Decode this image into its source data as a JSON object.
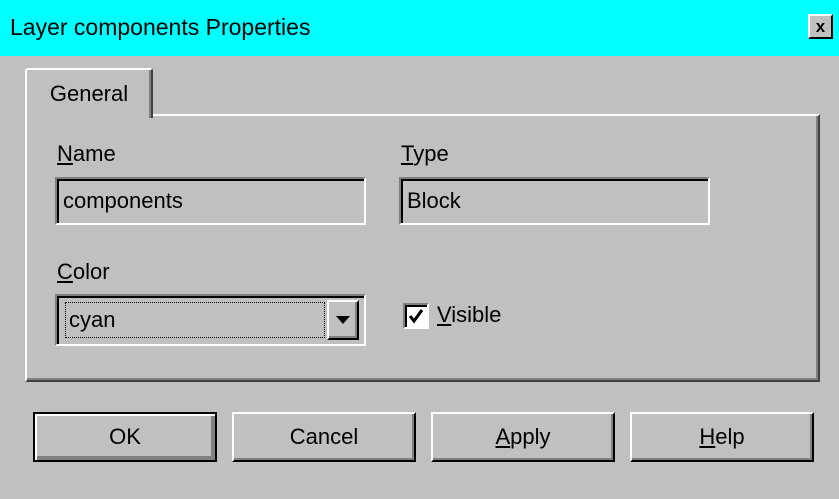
{
  "window": {
    "title": "Layer components Properties",
    "close_label": "x",
    "title_bar_color": "#00ffff"
  },
  "tabs": [
    {
      "label": "General",
      "selected": true
    }
  ],
  "general": {
    "name_label_mnemonic": "N",
    "name_label_rest": "ame",
    "name_value": "components",
    "type_label_mnemonic": "T",
    "type_label_rest": "ype",
    "type_value": "Block",
    "color_label_mnemonic": "C",
    "color_label_rest": "olor",
    "color_value": "cyan",
    "visible_label_mnemonic": "V",
    "visible_label_rest": "isible",
    "visible_checked": true
  },
  "buttons": {
    "ok": "OK",
    "cancel": "Cancel",
    "apply_mnemonic": "A",
    "apply_rest": "pply",
    "help_mnemonic": "H",
    "help_rest": "elp"
  },
  "icons": {
    "close": "close-icon",
    "dropdown": "chevron-down-icon",
    "check": "checkmark-icon"
  }
}
